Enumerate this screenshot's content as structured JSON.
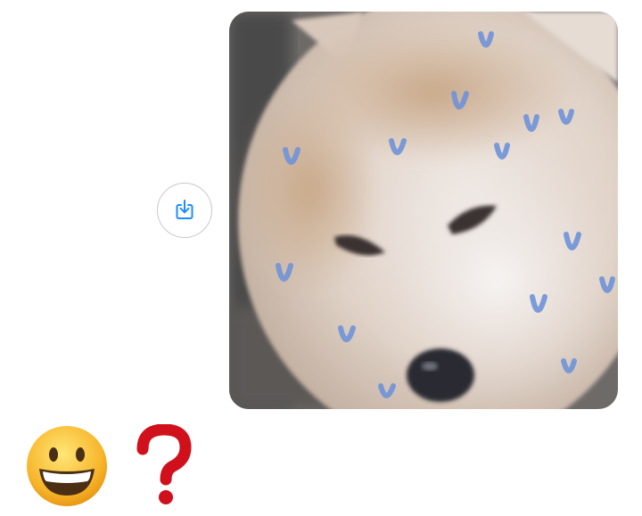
{
  "message_photo": {
    "subject": "shiba-inu-face",
    "overlay": "blue-hand-doodles"
  },
  "save_button": {
    "icon": "save-to-device-icon",
    "color": "#1a8cff"
  },
  "reply": {
    "emoji": "grinning-face",
    "mark": "red-question-mark",
    "mark_color": "#d0101a"
  }
}
